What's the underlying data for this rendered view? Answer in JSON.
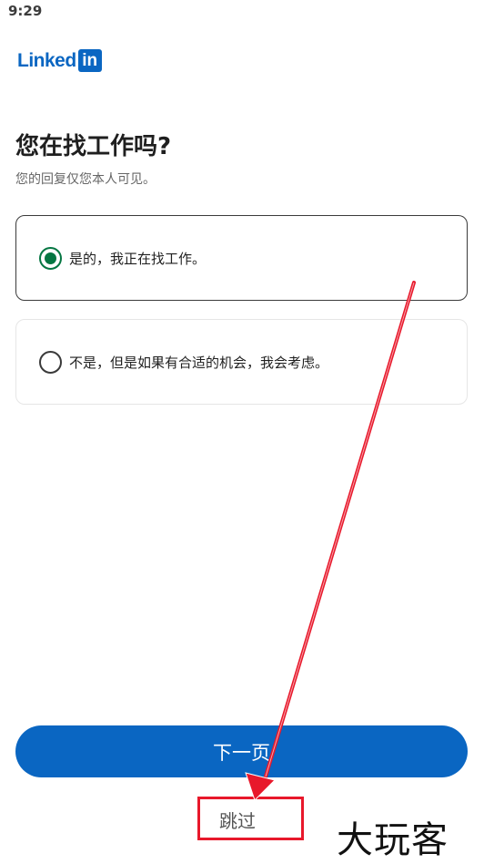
{
  "status_bar": {
    "time": "9:29"
  },
  "logo": {
    "text": "Linked",
    "box_text": "in"
  },
  "page": {
    "title": "您在找工作吗?",
    "subtitle": "您的回复仅您本人可见。"
  },
  "options": [
    {
      "label": "是的，我正在找工作。",
      "selected": true
    },
    {
      "label": "不是，但是如果有合适的机会，我会考虑。",
      "selected": false
    }
  ],
  "actions": {
    "next_label": "下一页",
    "skip_label": "跳过"
  },
  "watermark": {
    "text": "大玩客"
  },
  "colors": {
    "brand_blue": "#0a66c2",
    "radio_green": "#057642",
    "annotation_red": "#e8182b"
  }
}
